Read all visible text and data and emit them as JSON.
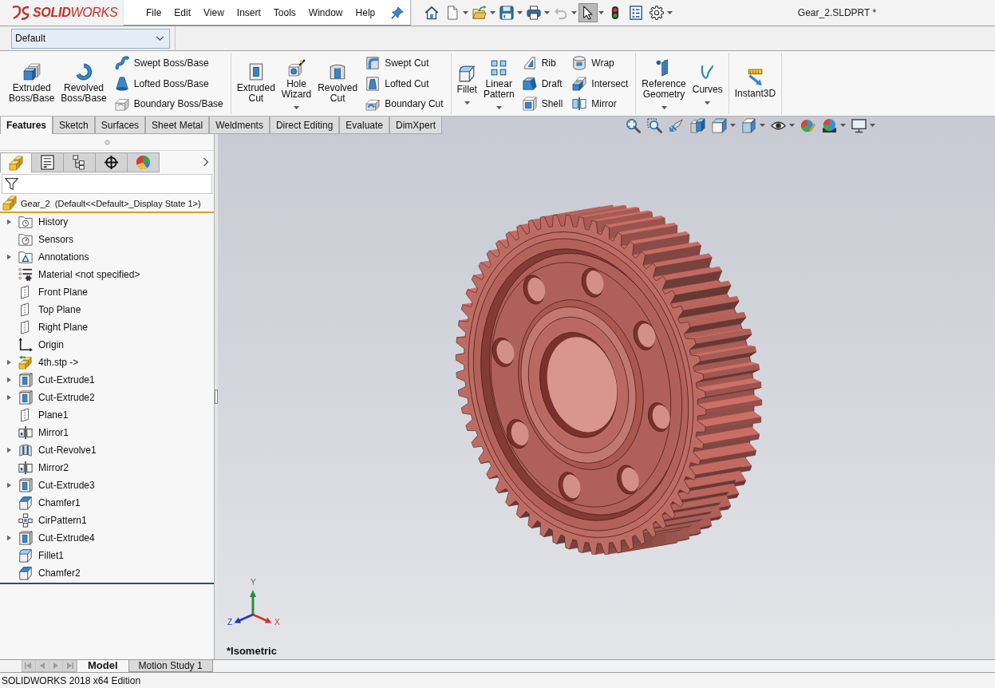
{
  "title_bar": {
    "logo": "**SOLID**WORKS",
    "menu": [
      "File",
      "Edit",
      "View",
      "Insert",
      "Tools",
      "Window",
      "Help"
    ],
    "quick_access_toolbar": [
      {
        "kind": "home",
        "dropdown": false,
        "disabled": false,
        "pressed": false
      },
      {
        "kind": "new",
        "dropdown": true,
        "disabled": false,
        "pressed": false
      },
      {
        "kind": "open",
        "dropdown": true,
        "disabled": false,
        "pressed": false
      },
      {
        "kind": "save",
        "dropdown": true,
        "disabled": false,
        "pressed": false
      },
      {
        "kind": "print",
        "dropdown": true,
        "disabled": false,
        "pressed": false
      },
      {
        "kind": "undo",
        "dropdown": true,
        "disabled": true,
        "pressed": false
      },
      {
        "kind": "select",
        "dropdown": true,
        "disabled": false,
        "pressed": true
      },
      {
        "kind": "rebuild",
        "dropdown": false,
        "disabled": false,
        "pressed": false
      },
      {
        "kind": "properties",
        "dropdown": false,
        "disabled": false,
        "pressed": false
      },
      {
        "kind": "options",
        "dropdown": true,
        "disabled": false,
        "pressed": false
      }
    ],
    "document_title": "Gear_2.SLDPRT *"
  },
  "configuration_selector": {
    "value": "Default"
  },
  "ribbon": {
    "groups": [
      {
        "large": [
          {
            "kind": "extruded-boss",
            "label": "Extruded Boss/Base",
            "dropdown": false
          },
          {
            "kind": "revolved-boss",
            "label": "Revolved Boss/Base",
            "dropdown": false
          }
        ],
        "small_columns": [
          [
            {
              "kind": "swept-boss",
              "label": "Swept Boss/Base"
            },
            {
              "kind": "lofted-boss",
              "label": "Lofted Boss/Base"
            },
            {
              "kind": "boundary-boss",
              "label": "Boundary Boss/Base"
            }
          ]
        ]
      },
      {
        "large": [
          {
            "kind": "extruded-cut",
            "label": "Extruded Cut",
            "dropdown": false
          },
          {
            "kind": "hole-wizard",
            "label": "Hole Wizard",
            "dropdown": true
          },
          {
            "kind": "revolved-cut",
            "label": "Revolved Cut",
            "dropdown": false
          }
        ],
        "small_columns": [
          [
            {
              "kind": "swept-cut",
              "label": "Swept Cut"
            },
            {
              "kind": "lofted-cut",
              "label": "Lofted Cut"
            },
            {
              "kind": "boundary-cut",
              "label": "Boundary Cut"
            }
          ]
        ]
      },
      {
        "large": [
          {
            "kind": "fillet",
            "label": "Fillet",
            "dropdown": true
          },
          {
            "kind": "linear-pattern",
            "label": "Linear Pattern",
            "dropdown": true
          }
        ],
        "small_columns": [
          [
            {
              "kind": "rib",
              "label": "Rib"
            },
            {
              "kind": "draft",
              "label": "Draft"
            },
            {
              "kind": "shell",
              "label": "Shell"
            }
          ],
          [
            {
              "kind": "wrap",
              "label": "Wrap"
            },
            {
              "kind": "intersect",
              "label": "Intersect"
            },
            {
              "kind": "mirror",
              "label": "Mirror"
            }
          ]
        ]
      },
      {
        "large": [
          {
            "kind": "reference-geometry",
            "label": "Reference Geometry",
            "dropdown": true
          },
          {
            "kind": "curves",
            "label": "Curves",
            "dropdown": true
          }
        ]
      },
      {
        "large": [
          {
            "kind": "instant3d",
            "label": "Instant3D",
            "dropdown": false
          }
        ]
      }
    ]
  },
  "command_tabs": [
    {
      "label": "Features",
      "selected": true
    },
    {
      "label": "Sketch",
      "selected": false
    },
    {
      "label": "Surfaces",
      "selected": false
    },
    {
      "label": "Sheet Metal",
      "selected": false
    },
    {
      "label": "Weldments",
      "selected": false
    },
    {
      "label": "Direct Editing",
      "selected": false
    },
    {
      "label": "Evaluate",
      "selected": false
    },
    {
      "label": "DimXpert",
      "selected": false
    }
  ],
  "heads_up_toolbar": [
    {
      "kind": "zoom-fit",
      "dropdown": false
    },
    {
      "kind": "zoom-area",
      "dropdown": false
    },
    {
      "kind": "previous-view",
      "dropdown": false
    },
    {
      "kind": "section-view",
      "dropdown": false
    },
    {
      "kind": "view-orientation",
      "dropdown": true
    },
    {
      "kind": "display-style",
      "dropdown": true
    },
    {
      "kind": "hide-show",
      "dropdown": true
    },
    {
      "kind": "edit-appearance",
      "dropdown": false
    },
    {
      "kind": "apply-scene",
      "dropdown": true
    },
    {
      "kind": "view-settings",
      "dropdown": true
    }
  ],
  "feature_manager": {
    "tabs": [
      {
        "kind": "features",
        "selected": true
      },
      {
        "kind": "properties",
        "selected": false
      },
      {
        "kind": "configurations",
        "selected": false
      },
      {
        "kind": "dimxpert",
        "selected": false
      },
      {
        "kind": "display",
        "selected": false
      }
    ],
    "root": "Gear_2  (Default<<Default>_Display State 1>)",
    "items": [
      {
        "kind": "history",
        "label": "History",
        "expandable": true
      },
      {
        "kind": "sensors",
        "label": "Sensors",
        "expandable": false
      },
      {
        "kind": "annotations",
        "label": "Annotations",
        "expandable": true
      },
      {
        "kind": "material",
        "label": "Material <not specified>",
        "expandable": false
      },
      {
        "kind": "plane",
        "label": "Front Plane",
        "expandable": false
      },
      {
        "kind": "plane",
        "label": "Top Plane",
        "expandable": false
      },
      {
        "kind": "plane",
        "label": "Right Plane",
        "expandable": false
      },
      {
        "kind": "origin",
        "label": "Origin",
        "expandable": false
      },
      {
        "kind": "imported-part",
        "label": "4th.stp ->",
        "expandable": true
      },
      {
        "kind": "cut-extrude",
        "label": "Cut-Extrude1",
        "expandable": true
      },
      {
        "kind": "cut-extrude",
        "label": "Cut-Extrude2",
        "expandable": true
      },
      {
        "kind": "plane",
        "label": "Plane1",
        "expandable": false
      },
      {
        "kind": "mirror",
        "label": "Mirror1",
        "expandable": false
      },
      {
        "kind": "cut-revolve",
        "label": "Cut-Revolve1",
        "expandable": true
      },
      {
        "kind": "mirror",
        "label": "Mirror2",
        "expandable": false
      },
      {
        "kind": "cut-extrude",
        "label": "Cut-Extrude3",
        "expandable": true
      },
      {
        "kind": "chamfer",
        "label": "Chamfer1",
        "expandable": false
      },
      {
        "kind": "circular-pattern",
        "label": "CirPattern1",
        "expandable": false
      },
      {
        "kind": "cut-extrude",
        "label": "Cut-Extrude4",
        "expandable": true
      },
      {
        "kind": "fillet",
        "label": "Fillet1",
        "expandable": false
      },
      {
        "kind": "chamfer",
        "label": "Chamfer2",
        "expandable": false
      }
    ]
  },
  "viewport": {
    "view_name": "*Isometric",
    "triad": {
      "x": "X",
      "y": "Y",
      "z": "Z"
    }
  },
  "bottom_tabs": {
    "navigation": [
      {
        "kind": "first",
        "disabled": true
      },
      {
        "kind": "previous",
        "disabled": true
      },
      {
        "kind": "next",
        "disabled": true
      },
      {
        "kind": "last",
        "disabled": true
      }
    ],
    "tabs": [
      {
        "label": "Model",
        "selected": true
      },
      {
        "label": "Motion Study 1",
        "selected": false
      }
    ]
  },
  "status_bar": {
    "text": "SOLIDWORKS 2018 x64 Edition"
  }
}
